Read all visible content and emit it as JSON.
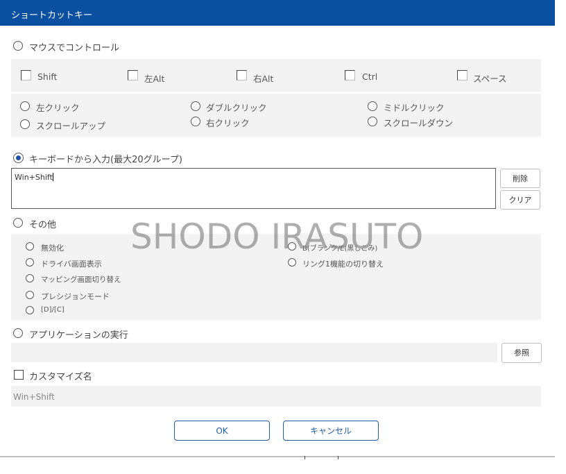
{
  "dialog": {
    "title": "ショートカットキー"
  },
  "mouse": {
    "label": "マウスでコントロール",
    "modifiers": [
      "Shift",
      "左Alt",
      "右Alt",
      "Ctrl",
      "スペース"
    ],
    "clicks": [
      [
        "左クリック",
        "スクロールアップ"
      ],
      [
        "ダブルクリック",
        "右クリック"
      ],
      [
        "ミドルクリック",
        "スクロールダウン"
      ]
    ]
  },
  "keyboard": {
    "label": "キーボードから入力(最大20グループ)",
    "value": "Win+Shift",
    "delete_label": "削除",
    "clear_label": "クリア"
  },
  "other": {
    "label": "その他",
    "left_items": [
      "無効化",
      "ドライバ画面表示",
      "マッピング画面切り替え",
      "プレシジョンモード",
      "[D]/[C]"
    ],
    "right_items": [
      "B(ブランク/E(黒しこみ)",
      "リング1機能の切り替え"
    ]
  },
  "app": {
    "label": "アプリケーションの実行",
    "browse_label": "参照"
  },
  "custom_name": {
    "label": "カスタマイズ名",
    "value": "Win+Shift"
  },
  "footer": {
    "ok_label": "OK",
    "cancel_label": "キャンセル"
  },
  "watermark": "SHODO IRASUTO",
  "colors": {
    "titlebar": "#0a4fa0",
    "accent": "#1f5aa8",
    "panel": "#f3f3f3"
  }
}
